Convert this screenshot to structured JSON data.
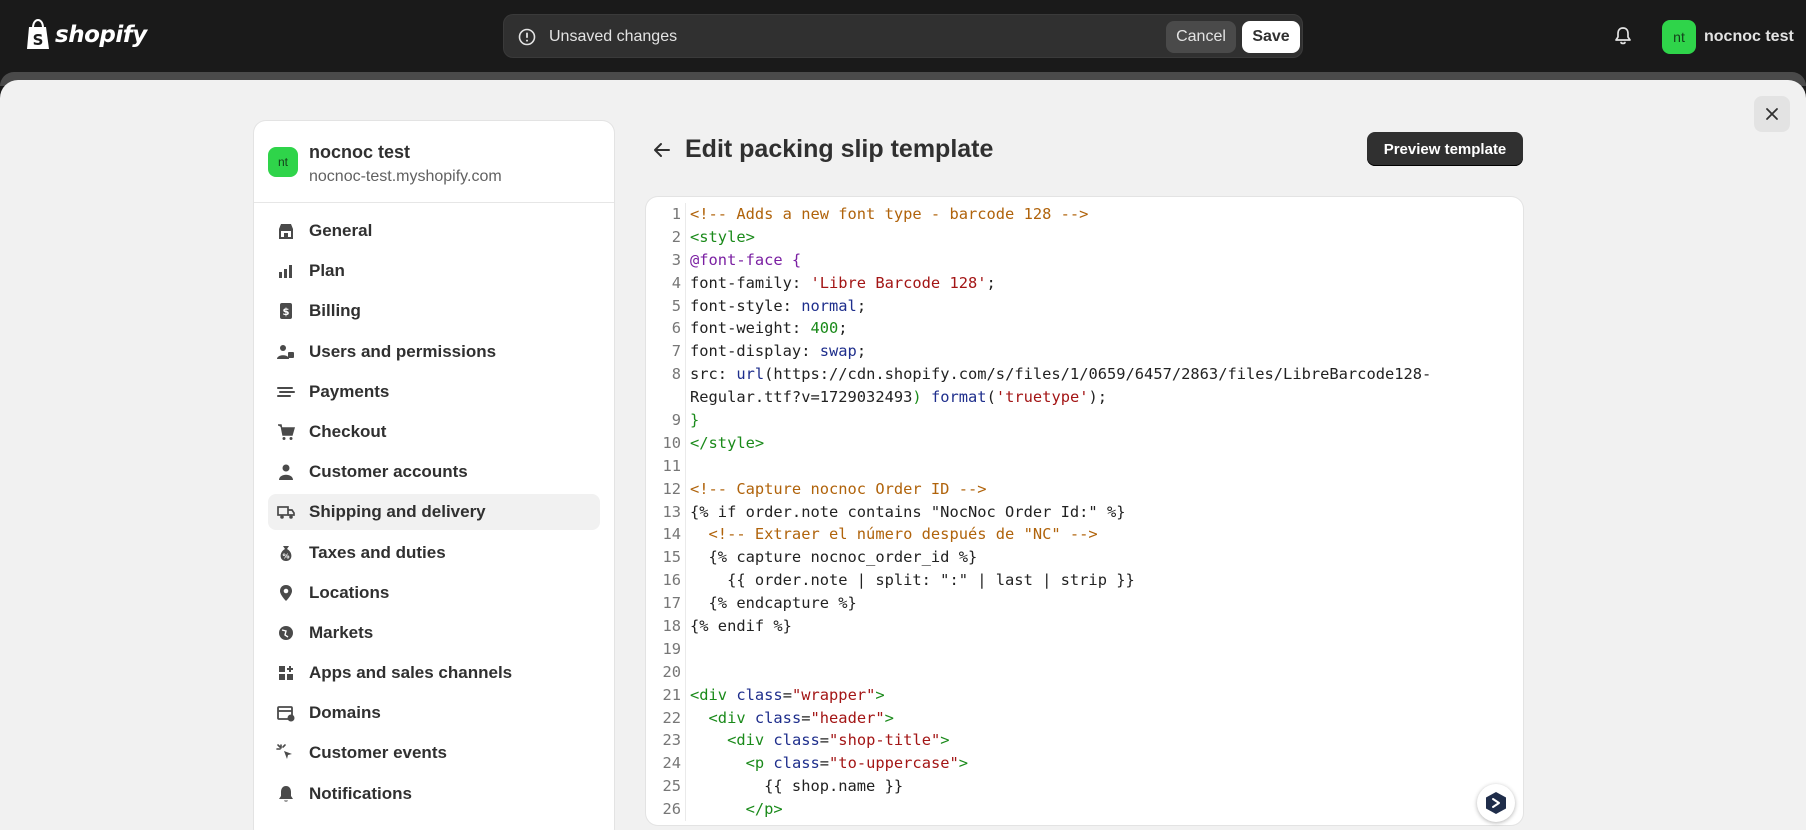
{
  "topbar": {
    "brand": "shopify",
    "unsaved_label": "Unsaved changes",
    "cancel_label": "Cancel",
    "save_label": "Save",
    "user_initials": "nt",
    "user_name": "nocnoc test"
  },
  "sidebar": {
    "store_initials": "nt",
    "store_name": "nocnoc test",
    "store_domain": "nocnoc-test.myshopify.com",
    "items": [
      {
        "label": "General",
        "icon": "store-icon"
      },
      {
        "label": "Plan",
        "icon": "plan-icon"
      },
      {
        "label": "Billing",
        "icon": "billing-icon"
      },
      {
        "label": "Users and permissions",
        "icon": "users-icon"
      },
      {
        "label": "Payments",
        "icon": "payments-icon"
      },
      {
        "label": "Checkout",
        "icon": "cart-icon"
      },
      {
        "label": "Customer accounts",
        "icon": "person-icon"
      },
      {
        "label": "Shipping and delivery",
        "icon": "truck-icon",
        "active": true
      },
      {
        "label": "Taxes and duties",
        "icon": "taxes-icon"
      },
      {
        "label": "Locations",
        "icon": "location-icon"
      },
      {
        "label": "Markets",
        "icon": "globe-icon"
      },
      {
        "label": "Apps and sales channels",
        "icon": "apps-icon"
      },
      {
        "label": "Domains",
        "icon": "domains-icon"
      },
      {
        "label": "Customer events",
        "icon": "cursor-icon"
      },
      {
        "label": "Notifications",
        "icon": "bell-icon"
      }
    ]
  },
  "main": {
    "title": "Edit packing slip template",
    "preview_label": "Preview template"
  },
  "editor": {
    "lines": [
      {
        "n": "1",
        "tokens": [
          [
            "c-comment",
            "<!-- Adds a new font type - barcode 128 -->"
          ]
        ]
      },
      {
        "n": "2",
        "tokens": [
          [
            "c-tag",
            "<style>"
          ]
        ]
      },
      {
        "n": "3",
        "tokens": [
          [
            "c-at",
            "@font-face {"
          ]
        ]
      },
      {
        "n": "4",
        "tokens": [
          [
            "c-plain",
            "font-family: "
          ],
          [
            "c-str",
            "'Libre Barcode 128'"
          ],
          [
            "c-plain",
            ";"
          ]
        ]
      },
      {
        "n": "5",
        "tokens": [
          [
            "c-plain",
            "font-style: "
          ],
          [
            "c-kw",
            "normal"
          ],
          [
            "c-plain",
            ";"
          ]
        ]
      },
      {
        "n": "6",
        "tokens": [
          [
            "c-plain",
            "font-weight: "
          ],
          [
            "c-num",
            "400"
          ],
          [
            "c-plain",
            ";"
          ]
        ]
      },
      {
        "n": "7",
        "tokens": [
          [
            "c-plain",
            "font-display: "
          ],
          [
            "c-kw",
            "swap"
          ],
          [
            "c-plain",
            ";"
          ]
        ]
      },
      {
        "n": "8",
        "tokens": [
          [
            "c-plain",
            "src: "
          ],
          [
            "c-kw",
            "url"
          ],
          [
            "c-plain",
            "(https://cdn.shopify.com/s/files/1/0659/6457/2863/files/LibreBarcode128-"
          ]
        ]
      },
      {
        "n": "",
        "tokens": [
          [
            "c-plain",
            "Regular.ttf?v=1729032493"
          ],
          [
            "c-tag",
            ")"
          ],
          [
            "c-plain",
            " "
          ],
          [
            "c-kw",
            "format"
          ],
          [
            "c-plain",
            "("
          ],
          [
            "c-str",
            "'truetype'"
          ],
          [
            "c-plain",
            ");"
          ]
        ]
      },
      {
        "n": "9",
        "tokens": [
          [
            "c-tag",
            "}"
          ]
        ]
      },
      {
        "n": "10",
        "tokens": [
          [
            "c-tag",
            "</style>"
          ]
        ]
      },
      {
        "n": "11",
        "tokens": []
      },
      {
        "n": "12",
        "tokens": [
          [
            "c-comment",
            "<!-- Capture nocnoc Order ID -->"
          ]
        ]
      },
      {
        "n": "13",
        "tokens": [
          [
            "c-plain",
            "{% if order.note contains \"NocNoc Order Id:\" %}"
          ]
        ]
      },
      {
        "n": "14",
        "tokens": [
          [
            "c-comment",
            "  <!-- Extraer el número después de \"NC\" -->"
          ]
        ]
      },
      {
        "n": "15",
        "tokens": [
          [
            "c-plain",
            "  {% capture nocnoc_order_id %}"
          ]
        ]
      },
      {
        "n": "16",
        "tokens": [
          [
            "c-plain",
            "    {{ order.note | split: \":\" | last | strip }}"
          ]
        ]
      },
      {
        "n": "17",
        "tokens": [
          [
            "c-plain",
            "  {% endcapture %}"
          ]
        ]
      },
      {
        "n": "18",
        "tokens": [
          [
            "c-plain",
            "{% endif %}"
          ]
        ]
      },
      {
        "n": "19",
        "tokens": []
      },
      {
        "n": "20",
        "tokens": []
      },
      {
        "n": "21",
        "tokens": [
          [
            "c-tag",
            "<div "
          ],
          [
            "c-kw",
            "class"
          ],
          [
            "c-plain",
            "="
          ],
          [
            "c-str",
            "\"wrapper\""
          ],
          [
            "c-tag",
            ">"
          ]
        ]
      },
      {
        "n": "22",
        "tokens": [
          [
            "c-tag",
            "  <div "
          ],
          [
            "c-kw",
            "class"
          ],
          [
            "c-plain",
            "="
          ],
          [
            "c-str",
            "\"header\""
          ],
          [
            "c-tag",
            ">"
          ]
        ]
      },
      {
        "n": "23",
        "tokens": [
          [
            "c-tag",
            "    <div "
          ],
          [
            "c-kw",
            "class"
          ],
          [
            "c-plain",
            "="
          ],
          [
            "c-str",
            "\"shop-title\""
          ],
          [
            "c-tag",
            ">"
          ]
        ]
      },
      {
        "n": "24",
        "tokens": [
          [
            "c-tag",
            "      <p "
          ],
          [
            "c-kw",
            "class"
          ],
          [
            "c-plain",
            "="
          ],
          [
            "c-str",
            "\"to-uppercase\""
          ],
          [
            "c-tag",
            ">"
          ]
        ]
      },
      {
        "n": "25",
        "tokens": [
          [
            "c-plain",
            "        {{ shop.name }}"
          ]
        ]
      },
      {
        "n": "26",
        "tokens": [
          [
            "c-tag",
            "      </p>"
          ]
        ]
      }
    ]
  }
}
